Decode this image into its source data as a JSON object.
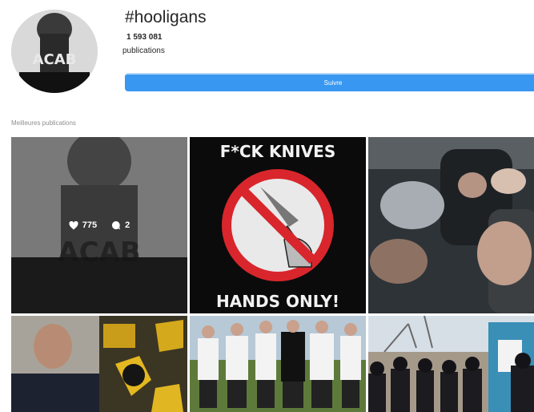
{
  "hashtag": {
    "title": "#hooligans",
    "post_count": "1 593 081",
    "post_label": "publications"
  },
  "follow_button": {
    "label": "Suivre"
  },
  "section": {
    "title": "Meilleures publications"
  },
  "posts": [
    {
      "likes": "775",
      "comments": "2"
    },
    {
      "headline": "F*CK KNIVES",
      "footer": "HANDS ONLY!"
    },
    {},
    {},
    {},
    {}
  ],
  "colors": {
    "accent": "#3897f0",
    "text": "#262626",
    "muted": "#8e8e8e",
    "no_sign": "#d8262c"
  }
}
